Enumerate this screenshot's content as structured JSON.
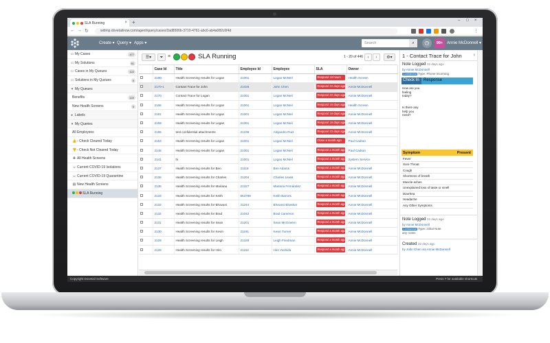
{
  "browser": {
    "tab_title": "SLA Running",
    "url": "wdimp.dovetailnow.com/agent/query/cases/2ad8506b-3710-4761-abc6-ab4a082c6f4d"
  },
  "header": {
    "menus": [
      "Create",
      "Query",
      "Apps"
    ],
    "search_placeholder": "Search",
    "notifications": "99+",
    "user": "Annie McDonnell"
  },
  "sidebar": {
    "items": [
      {
        "label": "My Cases",
        "count": "477",
        "icon": "folder-icon"
      },
      {
        "label": "My Solutions",
        "count": "51",
        "icon": "folder-icon"
      },
      {
        "label": "Cases in My Queues",
        "count": "122",
        "icon": "folder-icon"
      },
      {
        "label": "Solutions in My Queues",
        "count": "0",
        "icon": "folder-icon"
      },
      {
        "label": "My Queues",
        "count": "",
        "icon": "caret-down-icon"
      },
      {
        "label": "Benefits",
        "count": "122",
        "icon": ""
      },
      {
        "label": "New Health Screens",
        "count": "0",
        "icon": ""
      },
      {
        "label": "Labels",
        "count": "",
        "icon": "caret-right-icon"
      },
      {
        "label": "My Queries",
        "count": "",
        "icon": "caret-down-icon"
      },
      {
        "label": "All Employees",
        "count": "",
        "icon": ""
      },
      {
        "label": "- Check Cleared Today",
        "count": "",
        "icon": "thumb-up-icon"
      },
      {
        "label": "- Check Not Cleared Today",
        "count": "",
        "icon": "thumb-down-icon"
      },
      {
        "label": "All Health Screens",
        "count": "",
        "icon": "bag-icon"
      },
      {
        "label": "Current COVID-19 Isolations",
        "count": "",
        "icon": "smiley-icon"
      },
      {
        "label": "Current COVID-19 Quarantine",
        "count": "",
        "icon": "smiley-icon"
      },
      {
        "label": "New Health Screens",
        "count": "",
        "icon": "doc-icon"
      },
      {
        "label": "SLA Running",
        "count": "",
        "icon": "traffic-lights-icon"
      }
    ]
  },
  "main": {
    "title": "SLA Running",
    "pager": "1 - 20 of 446",
    "columns": [
      "",
      "Case Id",
      "Title",
      "Employee Id",
      "Employee",
      "SLA",
      "Owner"
    ],
    "rows": [
      {
        "id": "2190",
        "title": "Health Screening results for Logan",
        "emp_id": "21001",
        "emp": "Logan McNeil",
        "sla": "Respond 18 hours",
        "owner": "Health Screen"
      },
      {
        "id": "2170-1",
        "title": "Contact Trace for John",
        "emp_id": "21028",
        "emp": "John Chen",
        "sla": "Respond 22 days ago",
        "owner": "Annie McDonnell"
      },
      {
        "id": "2170",
        "title": "Contact Trace for Logan",
        "emp_id": "21001",
        "emp": "Logan McNeil",
        "sla": "Respond 22 days ago",
        "owner": "Annie McDonnell"
      },
      {
        "id": "2166",
        "title": "Health Screening results for Logan",
        "emp_id": "21001",
        "emp": "Logan McNeil",
        "sla": "Respond 16 days ago",
        "owner": "Health Screen"
      },
      {
        "id": "2161",
        "title": "Health Screening results for Logan",
        "emp_id": "21001",
        "emp": "Logan McNeil",
        "sla": "Respond 16 days ago",
        "owner": "Annie McDonnell"
      },
      {
        "id": "2159",
        "title": "Health Screening results for Logan",
        "emp_id": "21001",
        "emp": "Logan McNeil",
        "sla": "Respond 16 days ago",
        "owner": "Annie McDonnell"
      },
      {
        "id": "2155",
        "title": "test confidential attachments",
        "emp_id": "21239",
        "emp": "Alejandro Ruiz",
        "sla": "Respond 23 days ago",
        "owner": "Annie McDonnell"
      },
      {
        "id": "2153",
        "title": "Health Screening results for Logan",
        "emp_id": "21001",
        "emp": "Logan McNeil",
        "sla": "Close a month ago",
        "owner": "Paul Cadran"
      },
      {
        "id": "2146",
        "title": "Health Screening results for Logan",
        "emp_id": "21001",
        "emp": "Logan McNeil",
        "sla": "Respond a month ago",
        "owner": "Paul Cadran"
      },
      {
        "id": "2141",
        "title": "hi",
        "emp_id": "21001",
        "emp": "Logan McNeil",
        "sla": "Respond a month ago",
        "owner": "System Service"
      },
      {
        "id": "2137",
        "title": "Health Screening results for Ben",
        "emp_id": "21118",
        "emp": "Ben Adams",
        "sla": "Respond a month ago",
        "owner": "Annie McDonnell"
      },
      {
        "id": "2136",
        "title": "Health Screening results for Charles",
        "emp_id": "21204",
        "emp": "Charles Lewis",
        "sla": "Respond a month ago",
        "owner": "Annie McDonnell"
      },
      {
        "id": "2135",
        "title": "Health Screening results for Mariana",
        "emp_id": "21327",
        "emp": "Mariana Fernández",
        "sla": "Respond a month ago",
        "owner": "Annie McDonnell"
      },
      {
        "id": "2133",
        "title": "Health Screening results for Keith",
        "emp_id": "653789",
        "emp": "Keith Barnes",
        "sla": "Respond a month ago",
        "owner": "Annie McDonnell"
      },
      {
        "id": "2132",
        "title": "Health Screening results for Bhavani",
        "emp_id": "21164",
        "emp": "Bhavani Bhaskar",
        "sla": "Respond a month ago",
        "owner": "Annie McDonnell"
      },
      {
        "id": "2132",
        "title": "Health Screening results for Brad",
        "emp_id": "21042",
        "emp": "Brad Cameron",
        "sla": "Respond a month ago",
        "owner": "Annie McDonnell"
      },
      {
        "id": "2131",
        "title": "Health Screening results for Sean",
        "emp_id": "21201",
        "emp": "Sean McGovern",
        "sla": "Respond a month ago",
        "owner": "Annie McDonnell"
      },
      {
        "id": "2130",
        "title": "Health Screening results for Kevin",
        "emp_id": "21191",
        "emp": "Kevin Turner",
        "sla": "Respond a month ago",
        "owner": "Annie McDonnell"
      },
      {
        "id": "2129",
        "title": "Health Screening results for Leigh",
        "emp_id": "21228",
        "emp": "Leigh Friedman",
        "sla": "Respond a month ago",
        "owner": "Annie McDonnell"
      },
      {
        "id": "2128",
        "title": "Health Screening results for Hiro",
        "emp_id": "21152",
        "emp": "Hiro Yoshida",
        "sla": "Respond a month ago",
        "owner": "Annie McDonnell"
      }
    ]
  },
  "panel": {
    "title": "1 - Contact Trace for John",
    "note1": {
      "heading": "Note Logged",
      "ago": "22 days ago",
      "by": "by Annie McDonnell",
      "badge": "Confidential",
      "type": "Type: Phone Incoming"
    },
    "qa": {
      "col1": "Check In",
      "col2": "Response",
      "q1": "How are you feeling today?",
      "q2": "Is there any help you need?"
    },
    "symptoms": {
      "col1": "Symptom",
      "col2": "Present",
      "items": [
        "Fever",
        "Sore Throat",
        "Cough",
        "Shortness of breath",
        "Muscle aches",
        "Unexplained loss of taste or smell",
        "Diarrhea",
        "Headache",
        "Any Other Symptoms"
      ]
    },
    "note2": {
      "heading": "Note Logged",
      "ago": "22 days ago",
      "by": "by Annie McDonnell",
      "badge": "Confidential",
      "type": "Type: initial Note",
      "extra": "any notes"
    },
    "created": {
      "heading": "Created",
      "ago": "22 days ago",
      "by": "by John Chen via Annie McDonnell"
    }
  },
  "footer": {
    "left": "Copyright Dovetail Software",
    "right": "Press ? for available shortcuts"
  },
  "colors": {
    "header": "#6a7b89",
    "sla_red": "#e0393e",
    "accent_blue": "#3ba3d6",
    "symptom_yellow": "#f7c62f",
    "notif_magenta": "#cc4da0"
  }
}
